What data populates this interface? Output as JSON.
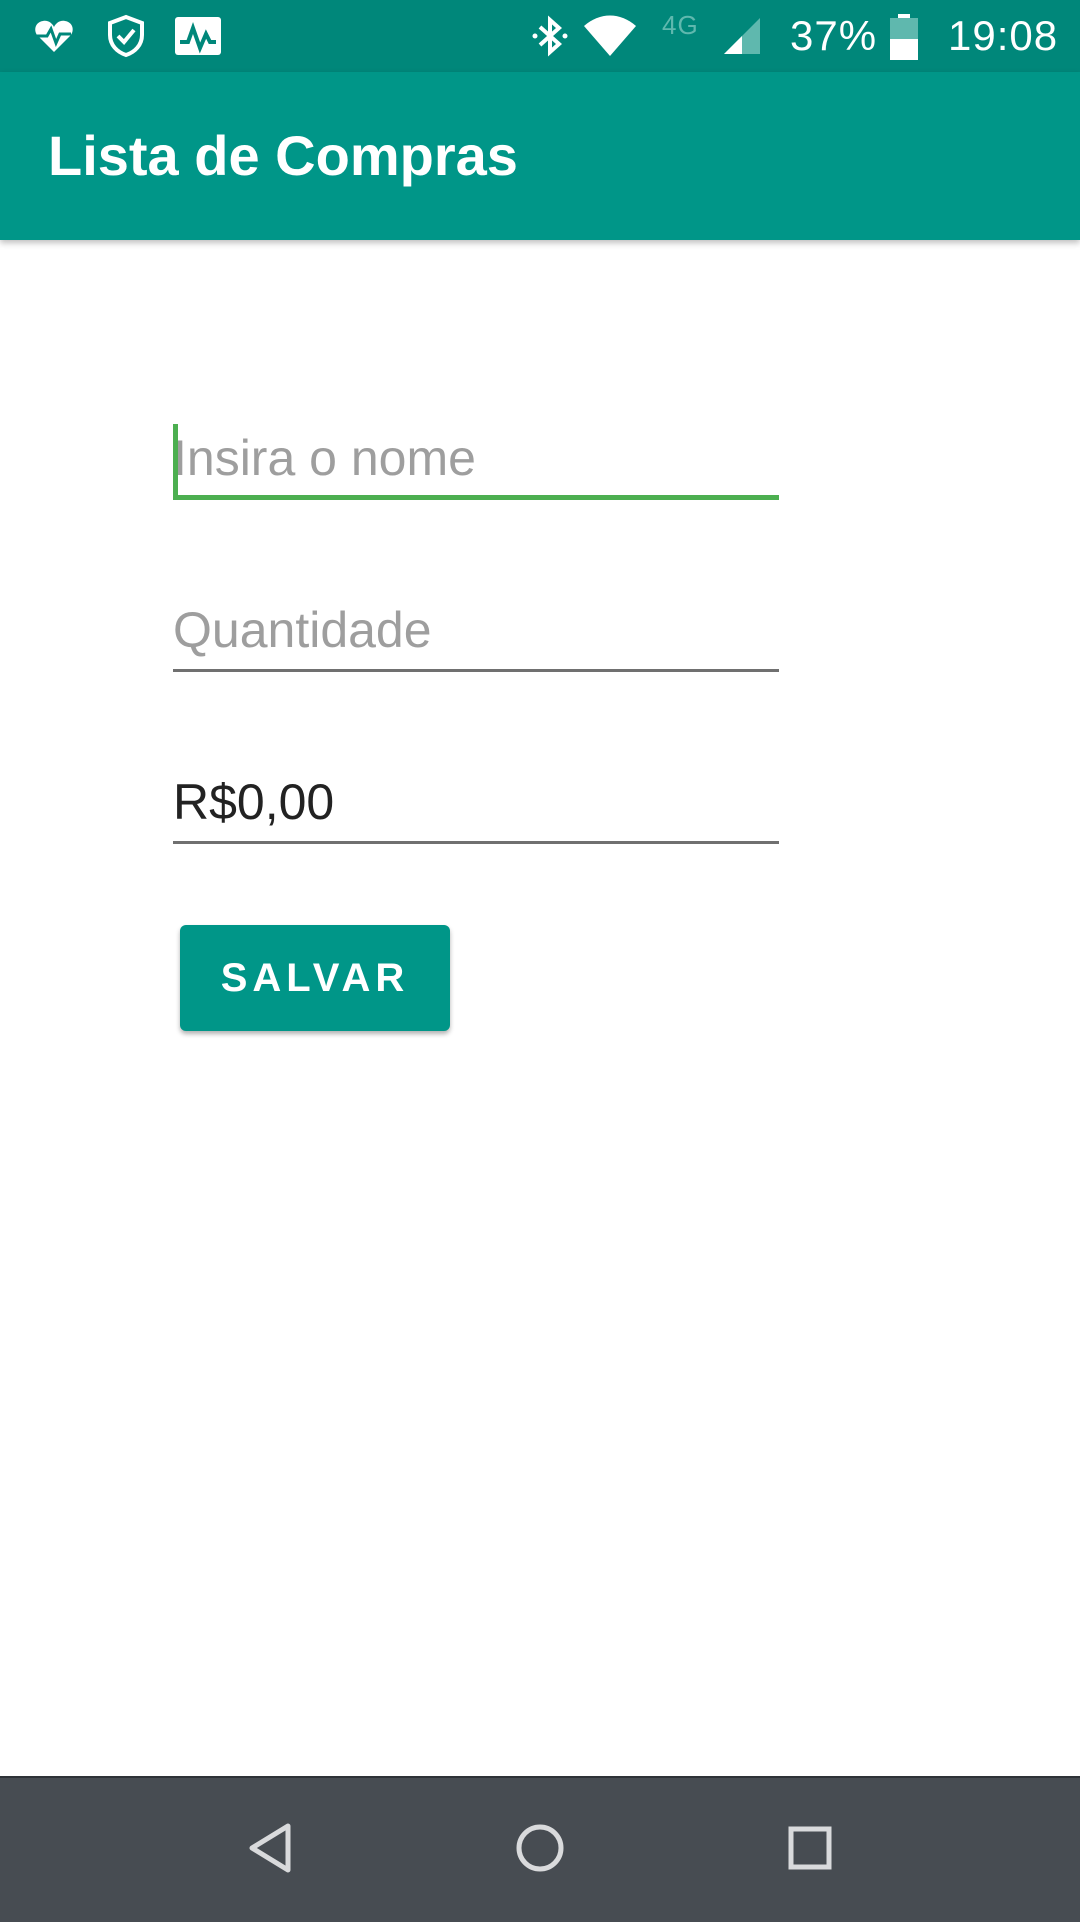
{
  "status_bar": {
    "battery_percent": "37%",
    "time": "19:08",
    "network_type": "4G",
    "left_icons": [
      "heart-rate-icon",
      "shield-check-icon",
      "activity-chart-icon"
    ],
    "right_icons": [
      "bluetooth-icon",
      "wifi-icon",
      "signal-icon",
      "battery-icon"
    ]
  },
  "app_bar": {
    "title": "Lista de Compras"
  },
  "form": {
    "name_placeholder": "Insira o nome",
    "name_value": "",
    "quantity_placeholder": "Quantidade",
    "quantity_value": "",
    "price_value": "R$0,00",
    "save_label": "SALVAR"
  },
  "colors": {
    "primary": "#009688",
    "primary_dark": "#00877A",
    "accent": "#4CAF50",
    "nav_bar": "#474C52"
  },
  "nav_bar": {
    "icons": [
      "back-icon",
      "home-icon",
      "recents-icon"
    ]
  }
}
